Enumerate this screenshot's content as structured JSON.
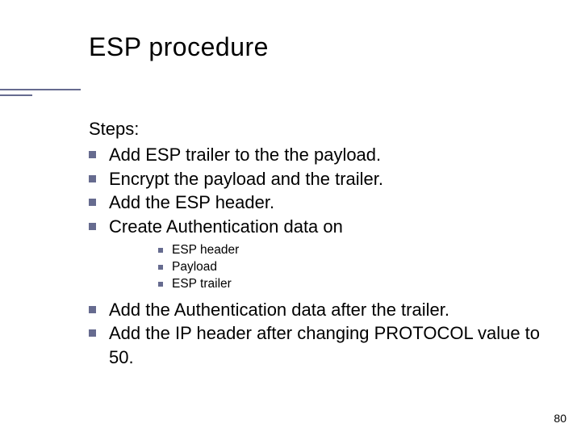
{
  "title": "ESP procedure",
  "steps_label": "Steps:",
  "steps_a": [
    "Add ESP trailer to the the payload.",
    "Encrypt the payload and the trailer.",
    "Add the ESP header.",
    "Create Authentication data on"
  ],
  "sub_items": [
    "ESP header",
    "Payload",
    "ESP trailer"
  ],
  "steps_b": [
    "Add the Authentication data after the trailer.",
    "Add the IP header after changing PROTOCOL value to 50."
  ],
  "page_number": "80"
}
